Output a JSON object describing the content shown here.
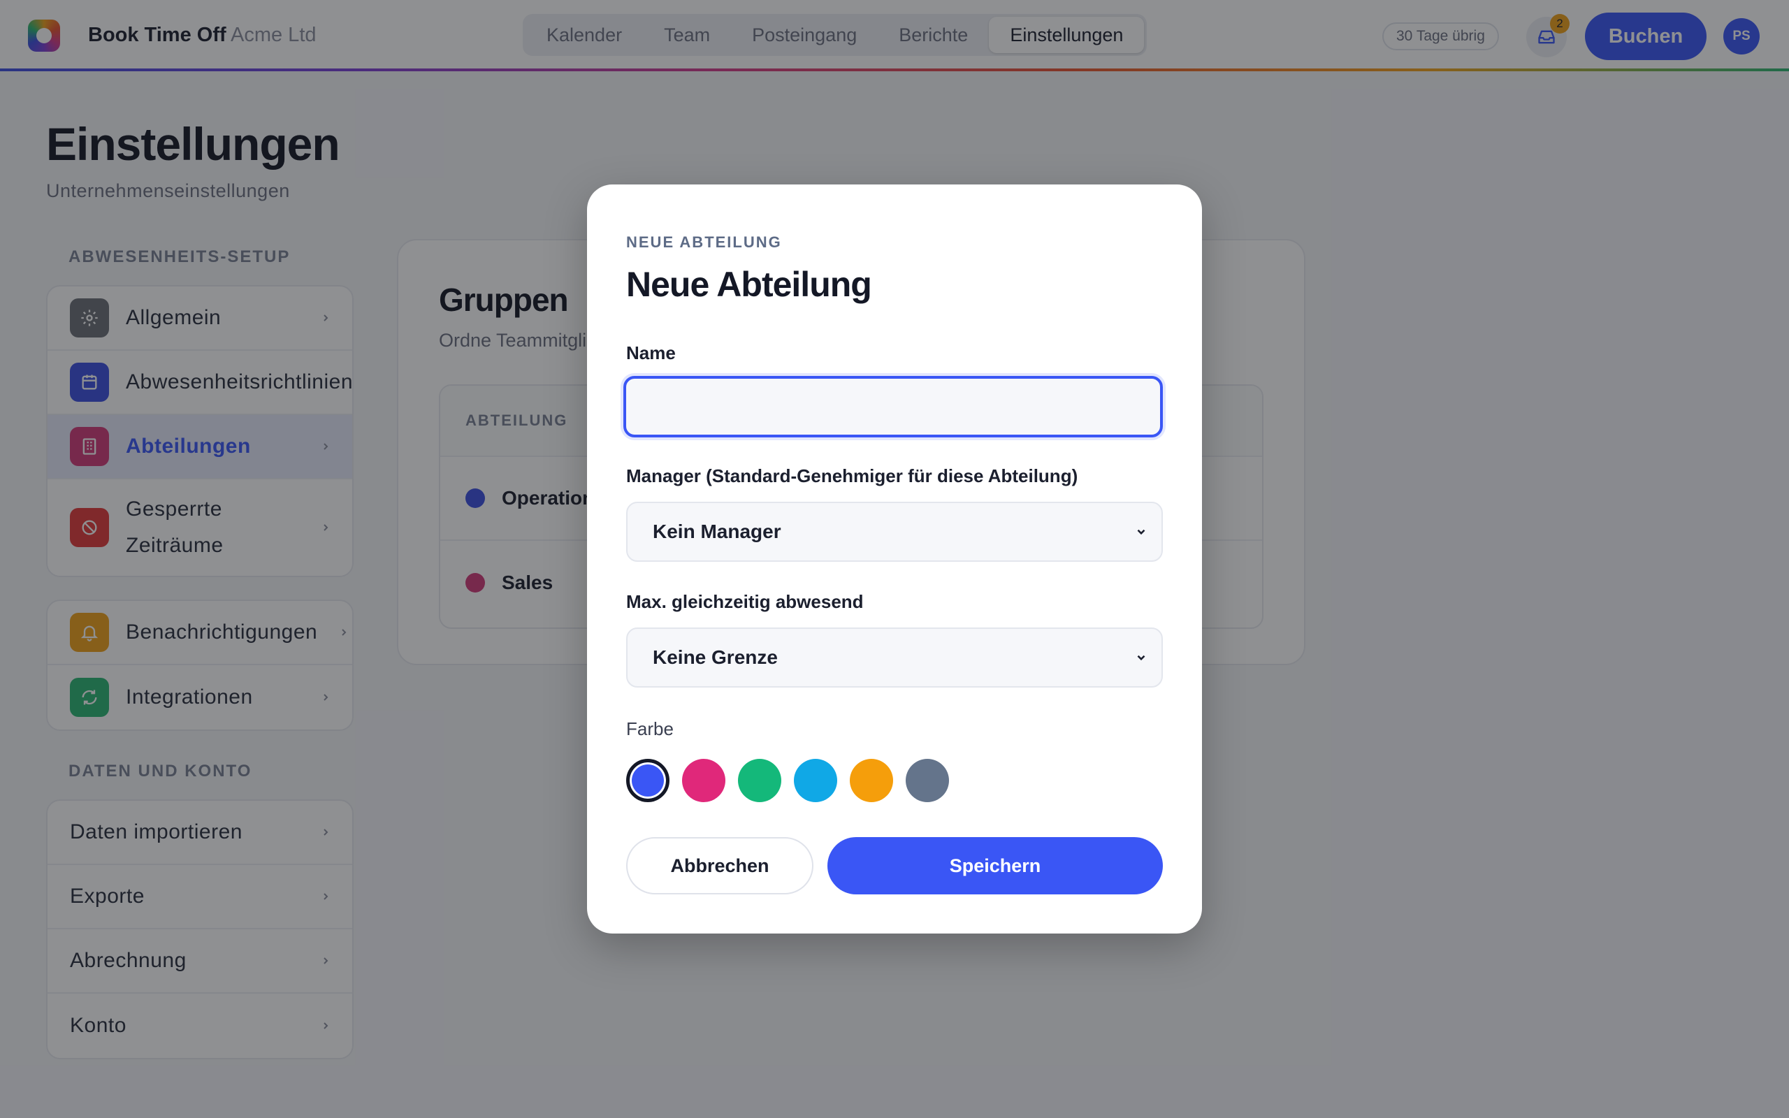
{
  "header": {
    "brand": "Book Time Off",
    "company": "Acme Ltd",
    "tabs": [
      {
        "label": "Kalender"
      },
      {
        "label": "Team"
      },
      {
        "label": "Posteingang"
      },
      {
        "label": "Berichte"
      },
      {
        "label": "Einstellungen",
        "active": true
      }
    ],
    "days_left": "30 Tage übrig",
    "inbox_count": "2",
    "book_label": "Buchen",
    "avatar_initials": "PS"
  },
  "page": {
    "title": "Einstellungen",
    "subtitle": "Unternehmenseinstellungen"
  },
  "sidebar": {
    "section1_label": "ABWESENHEITS-SETUP",
    "section1_items": [
      {
        "label": "Allgemein",
        "icon": "gear-icon",
        "color": "#6b6f78"
      },
      {
        "label": "Abwesenheitsrichtlinien",
        "icon": "calendar-icon",
        "color": "#3d4fe0"
      },
      {
        "label": "Abteilungen",
        "icon": "building-icon",
        "color": "#d23a7a",
        "active": true
      },
      {
        "label": "Gesperrte Zeiträume",
        "icon": "blocked-icon",
        "color": "#e23b3b"
      }
    ],
    "section2_items": [
      {
        "label": "Benachrichtigungen",
        "icon": "bell-icon",
        "color": "#f0a21a"
      },
      {
        "label": "Integrationen",
        "icon": "sync-icon",
        "color": "#2bb673"
      }
    ],
    "section3_label": "DATEN UND KONTO",
    "section3_items": [
      {
        "label": "Daten importieren"
      },
      {
        "label": "Exporte"
      },
      {
        "label": "Abrechnung"
      },
      {
        "label": "Konto"
      }
    ]
  },
  "groups": {
    "title": "Gruppen",
    "subtitle": "Ordne Teammitglieder",
    "column_header": "ABTEILUNG",
    "rows": [
      {
        "name": "Operations",
        "color": "#3d4fe0"
      },
      {
        "name": "Sales",
        "color": "#d23a7a"
      }
    ]
  },
  "modal": {
    "eyebrow": "NEUE ABTEILUNG",
    "title": "Neue Abteilung",
    "name_label": "Name",
    "name_value": "",
    "manager_label": "Manager (Standard-Genehmiger für diese Abteilung)",
    "manager_value": "Kein Manager",
    "max_label": "Max. gleichzeitig abwesend",
    "max_value": "Keine Grenze",
    "color_label": "Farbe",
    "colors": [
      "#3a56f5",
      "#e0287a",
      "#14b87a",
      "#10a8e6",
      "#f59e0b",
      "#64748b"
    ],
    "selected_color": "#3a56f5",
    "cancel_label": "Abbrechen",
    "save_label": "Speichern"
  }
}
